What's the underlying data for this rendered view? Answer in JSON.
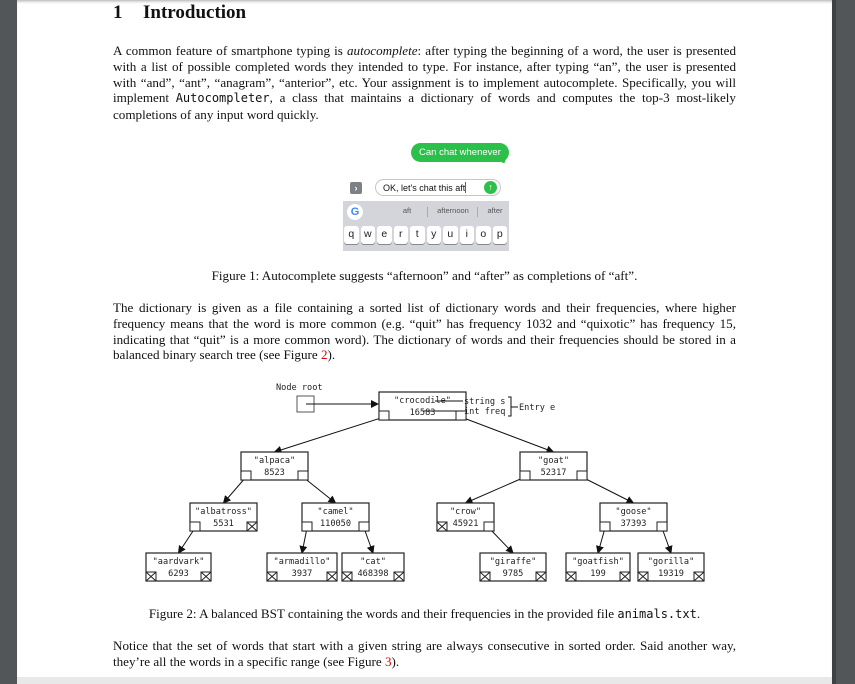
{
  "section": {
    "number": "1",
    "title": "Introduction"
  },
  "paragraph1": {
    "p1": "A common feature of smartphone typing is ",
    "em": "autocomplete",
    "p2": ": after typing the beginning of a word, the user is presented with a list of possible completed words they intended to type. For instance, after typing “an”, the user is presented with “and”, “ant”, “anagram”, “anterior”, etc. Your assignment is to implement autocomplete. Specifically, you will implement ",
    "code": "Autocompleter",
    "p3": ", a class that maintains a dictionary of words and computes the top-3 most-likely completions of any input word quickly."
  },
  "figure1": {
    "bubble": "Can chat whenever",
    "expand_glyph": "›",
    "input_value": "OK, let's chat this aft",
    "send_glyph": "↑",
    "google_glyph": "G",
    "suggestions": [
      "aft",
      "afternoon",
      "after"
    ],
    "keys": [
      "q",
      "w",
      "e",
      "r",
      "t",
      "y",
      "u",
      "i",
      "o",
      "p"
    ],
    "caption": "Figure 1: Autocomplete suggests “afternoon” and “after” as completions of “aft”."
  },
  "paragraph2": {
    "p1": "The dictionary is given as a file containing a sorted list of dictionary words and their frequencies, where higher frequency means that the word is more common (e.g. “quit” has frequency 1032 and “quixotic” has frequency 15, indicating that “quit” is a more common word). The dictionary of words and their frequencies should be stored in a balanced binary search tree (see Figure ",
    "ref": "2",
    "p2": ")."
  },
  "figure2": {
    "root_label": "Node root",
    "field_string": "string s",
    "field_freq": "int freq",
    "entry_label": "Entry e",
    "nodes": [
      {
        "word": "\"crocodile\"",
        "freq": "16583"
      },
      {
        "word": "\"alpaca\"",
        "freq": "8523"
      },
      {
        "word": "\"goat\"",
        "freq": "52317"
      },
      {
        "word": "\"albatross\"",
        "freq": "5531"
      },
      {
        "word": "\"camel\"",
        "freq": "110050"
      },
      {
        "word": "\"crow\"",
        "freq": "45921"
      },
      {
        "word": "\"goose\"",
        "freq": "37393"
      },
      {
        "word": "\"aardvark\"",
        "freq": "6293"
      },
      {
        "word": "\"armadillo\"",
        "freq": "3937"
      },
      {
        "word": "\"cat\"",
        "freq": "468398"
      },
      {
        "word": "\"giraffe\"",
        "freq": "9785"
      },
      {
        "word": "\"goatfish\"",
        "freq": "199"
      },
      {
        "word": "\"gorilla\"",
        "freq": "19319"
      }
    ],
    "caption_text": "Figure 2: A balanced BST containing the words and their frequencies in the provided file ",
    "caption_code": "animals.txt",
    "caption_end": "."
  },
  "paragraph3": {
    "p1": "Notice that the set of words that start with a given string are always consecutive in sorted order. Said another way, they’re all the words in a specific range (see Figure ",
    "ref": "3",
    "p2": ")."
  }
}
